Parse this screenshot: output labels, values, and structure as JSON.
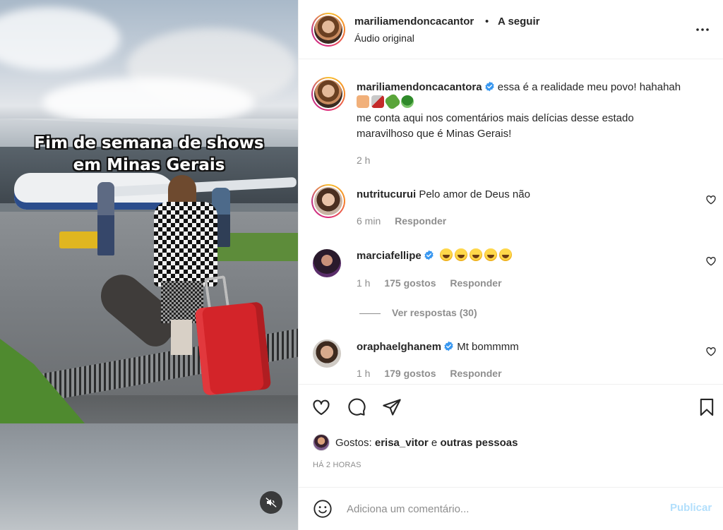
{
  "video": {
    "overlay_line1": "Fim de semana de shows",
    "overlay_line2": "em Minas Gerais",
    "mute_icon": "speaker-muted-icon"
  },
  "header": {
    "username": "mariliamendoncacantor",
    "separator": "•",
    "follow_label": "A seguir",
    "audio_label": "Áudio original",
    "more_icon": "more-horizontal-icon"
  },
  "caption": {
    "username": "mariliamendoncacantora",
    "text_line1": "essa é a realidade meu povo! hahahah",
    "emojis": [
      "flexed-biceps",
      "toast",
      "pickle",
      "broccoli"
    ],
    "text_line2": "me conta aqui nos comentários mais delícias desse estado",
    "text_line3": "maravilhoso que é Minas Gerais!",
    "time": "2 h"
  },
  "comments": [
    {
      "username": "nutritucurui",
      "text": "Pelo amor de Deus não",
      "time": "6 min",
      "likes": "",
      "reply_label": "Responder",
      "verified": false
    },
    {
      "username": "marciafellipe",
      "text": "",
      "emojis": [
        "rolling-laughing",
        "rolling-laughing",
        "grinning-sweat",
        "grinning-sweat",
        "rolling-laughing"
      ],
      "time": "1 h",
      "likes": "175 gostos",
      "reply_label": "Responder",
      "verified": true,
      "view_replies": "Ver respostas (30)"
    },
    {
      "username": "oraphaelghanem",
      "text": "Mt bommmm",
      "time": "1 h",
      "likes": "179 gostos",
      "reply_label": "Responder",
      "verified": true
    }
  ],
  "actions": {
    "like_icon": "heart-icon",
    "comment_icon": "comment-icon",
    "share_icon": "paper-plane-icon",
    "save_icon": "bookmark-icon",
    "likes_prefix": "Gostos:",
    "likes_user": "erisa_vitor",
    "likes_conj": "e",
    "likes_others": "outras pessoas",
    "time_ago": "HÁ 2 HORAS"
  },
  "composer": {
    "placeholder": "Adiciona um comentário...",
    "publish_label": "Publicar",
    "emoji_icon": "smiley-icon"
  },
  "colors": {
    "text": "#262626",
    "secondary": "#8e8e8e",
    "verified_blue": "#3897f0",
    "publish_disabled": "#b2dffc",
    "border": "#efefef"
  }
}
